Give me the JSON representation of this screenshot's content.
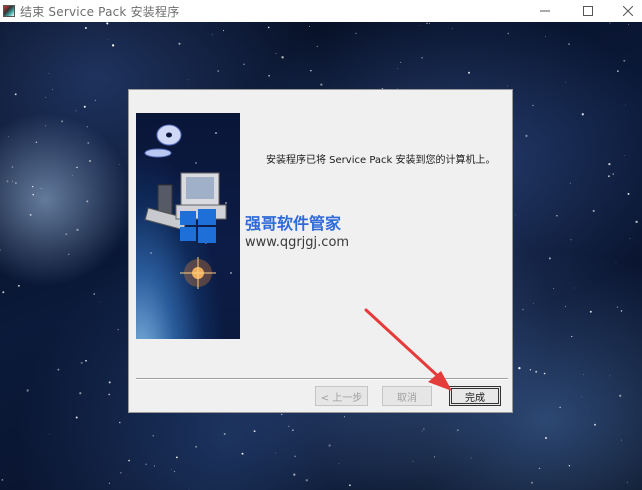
{
  "window": {
    "title": "结束 Service Pack 安装程序",
    "app_icon": "setup-icon",
    "controls": {
      "minimize": "minimize-icon",
      "maximize": "maximize-icon",
      "close": "close-icon"
    }
  },
  "dialog": {
    "message": "安装程序已将 Service Pack 安装到您的计算机上。",
    "watermark": {
      "name": "强哥软件管家",
      "url": "www.qgrjgj.com"
    },
    "buttons": {
      "back": {
        "label": "< 上一步",
        "enabled": false
      },
      "cancel": {
        "label": "取消",
        "enabled": false
      },
      "finish": {
        "label": "完成",
        "enabled": true
      }
    }
  },
  "annotation": {
    "type": "red-arrow-pointing-to-finish",
    "color": "#e53b3b"
  },
  "colors": {
    "watermark_blue": "#2e6bd9",
    "dialog_bg": "#f0f0f0",
    "arrow_red": "#e53b3b"
  }
}
